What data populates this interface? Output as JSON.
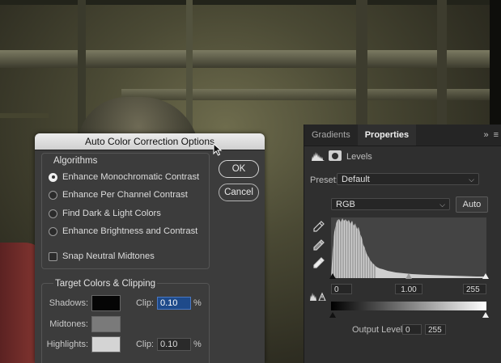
{
  "dialog": {
    "title": "Auto Color Correction Options",
    "algorithms_title": "Algorithms",
    "algorithms": [
      {
        "label": "Enhance Monochromatic Contrast",
        "selected": true
      },
      {
        "label": "Enhance Per Channel Contrast",
        "selected": false
      },
      {
        "label": "Find Dark & Light Colors",
        "selected": false
      },
      {
        "label": "Enhance Brightness and Contrast",
        "selected": false
      }
    ],
    "snap_label": "Snap Neutral Midtones",
    "snap_checked": false,
    "ok_label": "OK",
    "cancel_label": "Cancel",
    "target_title": "Target Colors & Clipping",
    "shadows_label": "Shadows:",
    "midtones_label": "Midtones:",
    "highlights_label": "Highlights:",
    "clip_label": "Clip:",
    "shadows_clip": "0.10",
    "highlights_clip": "0.10",
    "percent": "%",
    "colors": {
      "shadows": "#050505",
      "midtones": "#7a7a7a",
      "highlights": "#d4d4d4"
    }
  },
  "panel": {
    "tabs": [
      "Gradients",
      "Properties"
    ],
    "active_tab": "Properties",
    "menu_chevrons": "»",
    "menu_icon": "≡",
    "layer_type": "Levels",
    "preset_label": "Preset:",
    "preset_value": "Default",
    "channel_value": "RGB",
    "auto_label": "Auto",
    "input_black": "0",
    "input_gamma": "1.00",
    "input_white": "255",
    "output_label": "Output Levels:",
    "output_black": "0",
    "output_white": "255",
    "icons": [
      "histogram-icon",
      "mask-icon",
      "black-eyedropper-icon",
      "gray-eyedropper-icon",
      "white-eyedropper-icon",
      "clip-warning-icon",
      "mouse-cursor-icon"
    ]
  }
}
